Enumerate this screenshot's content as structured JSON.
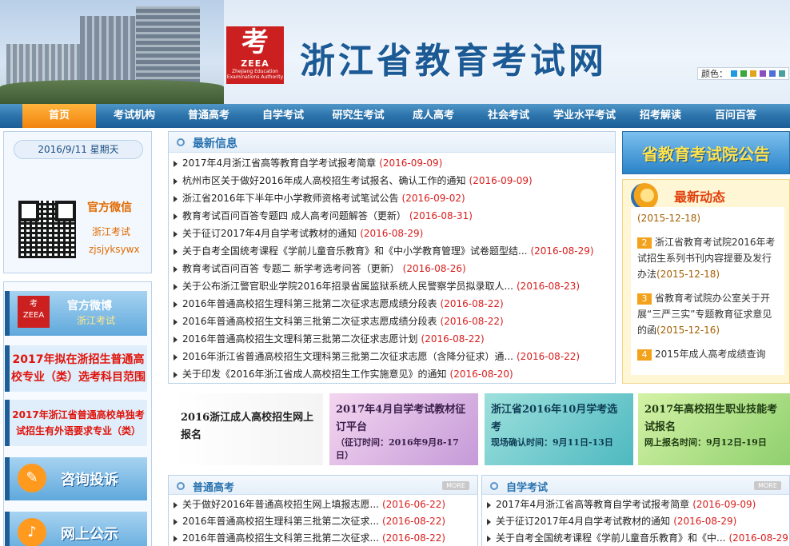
{
  "header": {
    "logo_char": "考",
    "logo_abbr": "ZEEA",
    "logo_sub": "Zhejiang Education Examinations Authority",
    "site_title": "浙江省教育考试网",
    "color_label": "颜色：",
    "color_swatches": [
      "#1e9be0",
      "#3aa83a",
      "#e0a51e",
      "#8b4fc2",
      "#4f6fd9",
      "#4aa0a0"
    ]
  },
  "nav": {
    "items": [
      "首页",
      "考试机构",
      "普通高考",
      "自学考试",
      "研究生考试",
      "成人高考",
      "社会考试",
      "学业水平考试",
      "招考解读",
      "百问百答"
    ],
    "active_index": 0
  },
  "left": {
    "date": "2016/9/11 星期天",
    "wechat_title": "官方微信",
    "wechat_name": "浙江考试",
    "wechat_id": "zjsjyksywx",
    "weibo_title": "官方微博",
    "weibo_name": "浙江考试",
    "banner_a": "2017年拟在浙招生普通高校专业（类）选考科目范围",
    "banner_b": "2017年浙江省普通高校单独考试招生有外语要求专业（类）",
    "consult_label": "咨询投诉",
    "publicity_label": "网上公示"
  },
  "latest": {
    "title": "最新信息",
    "items": [
      {
        "text": "2017年4月浙江省高等教育自学考试报考简章",
        "date": "(2016-09-09)"
      },
      {
        "text": "杭州市区关于做好2016年成人高校招生考试报名、确认工作的通知",
        "date": "(2016-09-09)"
      },
      {
        "text": "浙江省2016年下半年中小学教师资格考试笔试公告",
        "date": "(2016-09-02)"
      },
      {
        "text": "教育考试百问百答专题四 成人高考问题解答（更新）",
        "date": "(2016-08-31)"
      },
      {
        "text": "关于征订2017年4月自学考试教材的通知",
        "date": "(2016-08-29)"
      },
      {
        "text": "关于自考全国统考课程《学前儿童音乐教育》和《中小学教育管理》试卷题型结...",
        "date": "(2016-08-29)"
      },
      {
        "text": "教育考试百问百答 专题二 新学考选考问答（更新）",
        "date": "(2016-08-26)"
      },
      {
        "text": "关于公布浙江警官职业学院2016年招录省属监狱系统人民警察学员拟录取人...",
        "date": "(2016-08-23)"
      },
      {
        "text": "2016年普通高校招生理科第三批第二次征求志愿成绩分段表",
        "date": "(2016-08-22)"
      },
      {
        "text": "2016年普通高校招生文科第三批第二次征求志愿成绩分段表",
        "date": "(2016-08-22)"
      },
      {
        "text": "2016年普通高校招生文理科第三批第二次征求志愿计划",
        "date": "(2016-08-22)"
      },
      {
        "text": "2016年浙江省普通高校招生文理科第三批第二次征求志愿（含降分征求）通...",
        "date": "(2016-08-22)"
      },
      {
        "text": "关于印发《2016年浙江省成人高校招生工作实施意见》的通知",
        "date": "(2016-08-20)"
      }
    ]
  },
  "right": {
    "notice_label": "省教育考试院公告",
    "dynamics_title": "最新动态",
    "dynamics": [
      {
        "num": "",
        "text": "",
        "date": "(2015-12-18)"
      },
      {
        "num": "2",
        "text": "浙江省教育考试院2016年考试招生系列书刊内容提要及发行办法",
        "date": "(2015-12-18)"
      },
      {
        "num": "3",
        "text": "省教育考试院办公室关于开展“三严三实”专题教育征求意见的函",
        "date": "(2015-12-16)"
      },
      {
        "num": "4",
        "text": "2015年成人高考成绩查询",
        "date": ""
      }
    ]
  },
  "promos": [
    {
      "title": "2016浙江成人高校招生网上报名",
      "sub": ""
    },
    {
      "title": "2017年4月自学考试教材征订平台",
      "sub": "（征订时间：2016年9月8-17日）"
    },
    {
      "title": "浙江省2016年10月学考选考",
      "sub": "现场确认时间：9月11日-13日"
    },
    {
      "title": "2017年高校招生职业技能考试报名",
      "sub": "网上报名时间：9月12日-19日"
    }
  ],
  "gaokao": {
    "title": "普通高考",
    "more": "MORE",
    "items": [
      {
        "text": "关于做好2016年普通高校招生网上填报志愿...",
        "date": "(2016-06-22)"
      },
      {
        "text": "2016年普通高校招生理科第三批第二次征求...",
        "date": "(2016-08-22)"
      },
      {
        "text": "2016年普通高校招生文科第三批第二次征求...",
        "date": "(2016-08-22)"
      }
    ]
  },
  "zikao": {
    "title": "自学考试",
    "more": "MORE",
    "items": [
      {
        "text": "2017年4月浙江省高等教育自学考试报考简章",
        "date": "(2016-09-09)"
      },
      {
        "text": "关于征订2017年4月自学考试教材的通知",
        "date": "(2016-08-29)"
      },
      {
        "text": "关于自考全国统考课程《学前儿童音乐教育》和《中...",
        "date": "(2016-08-29)"
      }
    ]
  }
}
